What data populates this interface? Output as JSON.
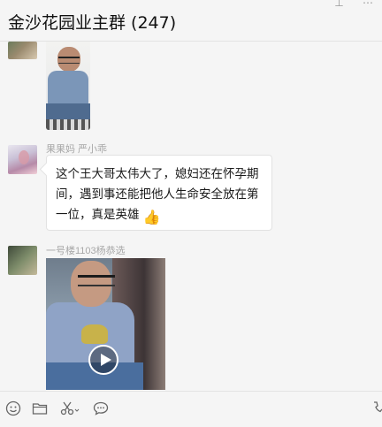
{
  "header": {
    "title": "金沙花园业主群 (247)",
    "icons": [
      "pin-icon",
      "more-icon"
    ]
  },
  "messages": [
    {
      "type": "image",
      "avatar": "avatar-image"
    },
    {
      "type": "text",
      "sender": "果果妈 严小乖",
      "text": "这个王大哥太伟大了，媳妇还在怀孕期间，遇到事还能把他人生命安全放在第一位，真是英雄",
      "emoji": "thumbs-up-icon"
    },
    {
      "type": "video",
      "sender": "一号楼1103杨恭选",
      "icon": "play-icon"
    }
  ],
  "toolbar": {
    "icons": [
      "emoji-icon",
      "folder-icon",
      "scissors-icon",
      "chat-bubble-icon",
      "phone-icon"
    ]
  }
}
